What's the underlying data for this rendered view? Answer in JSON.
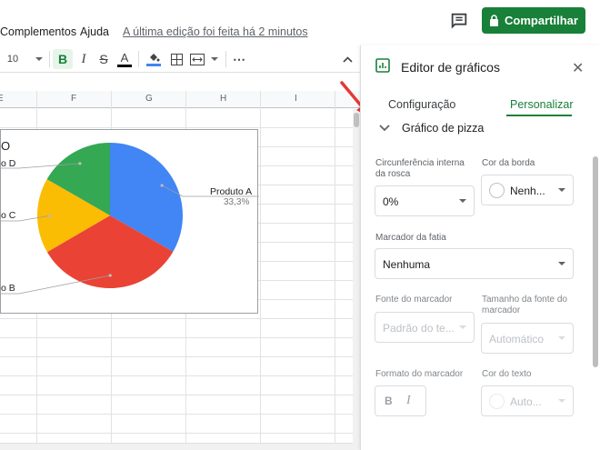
{
  "menubar": {
    "items": [
      "Complementos",
      "Ajuda"
    ],
    "last_edit": "A última edição foi feita há 2 minutos",
    "share_label": "Compartilhar"
  },
  "toolbar": {
    "font_size": "10",
    "icons": [
      "bold-icon",
      "italic-icon",
      "strikethrough-icon",
      "text-color-icon",
      "fill-color-icon",
      "borders-icon",
      "merge-cells-icon",
      "more-icon",
      "collapse-icon"
    ],
    "colors": {
      "text_color_bar": "#000000",
      "fill_color_bar": "#4285f4"
    }
  },
  "grid": {
    "columns": [
      "E",
      "F",
      "G",
      "H",
      "I"
    ]
  },
  "chart_data": {
    "type": "pie",
    "title": "O",
    "categories": [
      "Produto A",
      "Produto B",
      "Produto C",
      "Produto D"
    ],
    "values": [
      33.3,
      33.3,
      16.7,
      16.7
    ],
    "colors": [
      "#4285f4",
      "#ea4335",
      "#fbbc04",
      "#34a853"
    ],
    "labels": {
      "a_name": "Produto A",
      "a_pct": "33,3%",
      "b_name": "o B",
      "c_name": "o C",
      "d_name": "o D"
    }
  },
  "panel": {
    "title": "Editor de gráficos",
    "tabs": {
      "config": "Configuração",
      "custom": "Personalizar"
    },
    "section": "Gráfico de pizza",
    "fields": {
      "donut_label": "Circunferência interna da rosca",
      "donut_value": "0%",
      "border_label": "Cor da borda",
      "border_value": "Nenh...",
      "slice_label": "Marcador da fatia",
      "slice_value": "Nenhuma",
      "label_font_label": "Fonte do marcador",
      "label_font_value": "Padrão do te...",
      "label_size_label": "Tamanho da fonte do marcador",
      "label_size_value": "Automático",
      "label_format_label": "Formato do marcador",
      "text_color_label": "Cor do texto",
      "text_color_value": "Auto..."
    },
    "accent": "#188038"
  }
}
